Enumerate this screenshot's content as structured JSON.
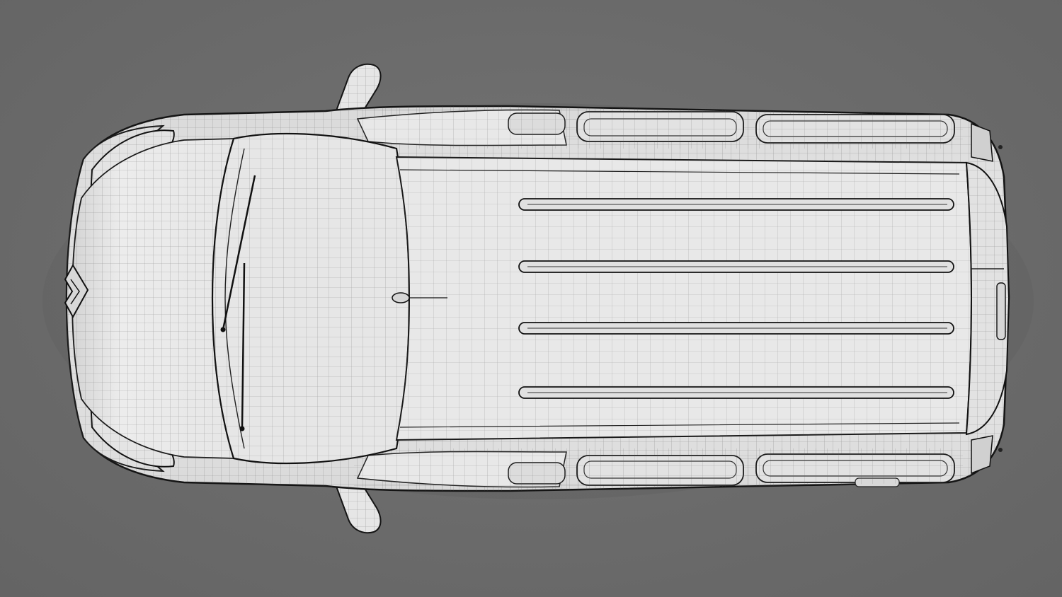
{
  "scene": {
    "background_color": "#6b6b6b",
    "body_color": "#e9e9e9",
    "wire_color": "#3a3a3a",
    "outline_color": "#141414"
  },
  "vehicle": {
    "view": "top",
    "roof_rails": 4,
    "emblem": "diamond-logo"
  }
}
